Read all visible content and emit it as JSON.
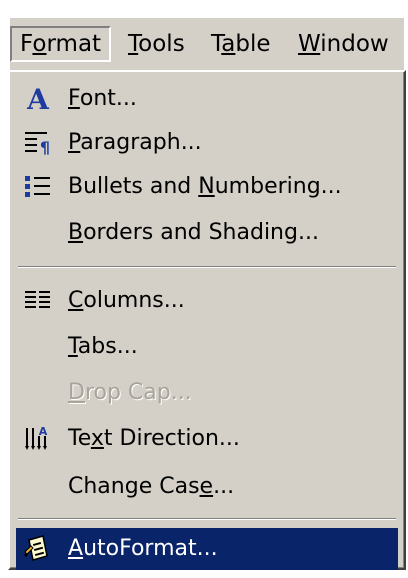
{
  "menubar": {
    "items": [
      {
        "label": "Format",
        "prefix": "F",
        "mnemonic": "o",
        "suffix": "rmat"
      },
      {
        "label": "Tools",
        "prefix": "",
        "mnemonic": "T",
        "suffix": "ools"
      },
      {
        "label": "Table",
        "prefix": "T",
        "mnemonic": "a",
        "suffix": "ble"
      },
      {
        "label": "Window",
        "prefix": "",
        "mnemonic": "W",
        "suffix": "indow"
      }
    ]
  },
  "menu": {
    "items": [
      {
        "label": "Font...",
        "prefix": "",
        "mnemonic": "F",
        "suffix": "ont...",
        "icon": "font-icon"
      },
      {
        "label": "Paragraph...",
        "prefix": "",
        "mnemonic": "P",
        "suffix": "aragraph...",
        "icon": "paragraph-icon"
      },
      {
        "label": "Bullets and Numbering...",
        "prefix": "Bullets and ",
        "mnemonic": "N",
        "suffix": "umbering...",
        "icon": "bullets-icon"
      },
      {
        "label": "Borders and Shading...",
        "prefix": "",
        "mnemonic": "B",
        "suffix": "orders and Shading..."
      },
      {
        "label": "Columns...",
        "prefix": "",
        "mnemonic": "C",
        "suffix": "olumns...",
        "icon": "columns-icon"
      },
      {
        "label": "Tabs...",
        "prefix": "",
        "mnemonic": "T",
        "suffix": "abs..."
      },
      {
        "label": "Drop Cap...",
        "prefix": "",
        "mnemonic": "D",
        "suffix": "rop Cap...",
        "disabled": true
      },
      {
        "label": "Text Direction...",
        "prefix": "Te",
        "mnemonic": "x",
        "suffix": "t Direction...",
        "icon": "text-direction-icon"
      },
      {
        "label": "Change Case...",
        "prefix": "Change Cas",
        "mnemonic": "e",
        "suffix": "...",
        "icon": null
      },
      {
        "label": "AutoFormat...",
        "prefix": "",
        "mnemonic": "A",
        "suffix": "utoFormat...",
        "icon": "autoformat-icon",
        "highlighted": true
      }
    ]
  },
  "colors": {
    "menu_bg": "#d4d0c8",
    "highlight_bg": "#0a246a",
    "icon_blue": "#1e3ca0",
    "disabled_text": "#a8a49c"
  }
}
